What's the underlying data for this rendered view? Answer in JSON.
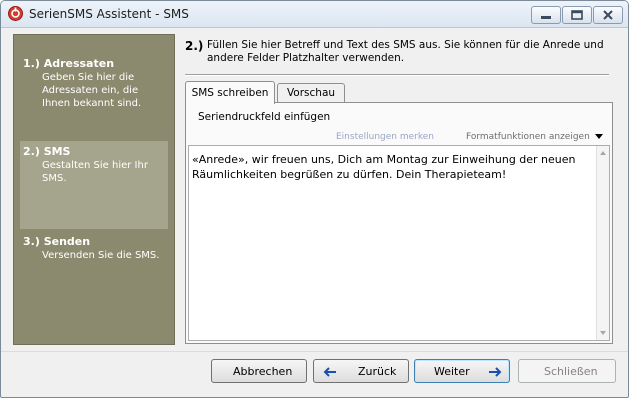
{
  "window": {
    "title": "SerienSMS Assistent - SMS",
    "icons": {
      "app": "app-icon",
      "minimize": "minimize-icon",
      "maximize": "maximize-icon",
      "close": "close-icon"
    }
  },
  "sidebar": {
    "steps": [
      {
        "title": "1.) Adressaten",
        "description": "Geben Sie hier die Adressaten ein, die Ihnen bekannt sind.",
        "active": false
      },
      {
        "title": "2.) SMS",
        "description": "Gestalten Sie hier Ihr SMS.",
        "active": true
      },
      {
        "title": "3.) Senden",
        "description": "Versenden Sie die SMS.",
        "active": false
      }
    ]
  },
  "header": {
    "number": "2.)",
    "text": "Füllen Sie hier Betreff und Text des SMS aus. Sie können für die Anrede und andere Felder Platzhalter verwenden."
  },
  "tabs": [
    {
      "label": "SMS schreiben",
      "active": true
    },
    {
      "label": "Vorschau",
      "active": false
    }
  ],
  "editor": {
    "merge_field_link": "Seriendruckfeld einfügen",
    "settings_link": "Einstellungen merken",
    "format_toggle": "Formatfunktionen anzeigen",
    "content": "«Anrede», wir freuen uns, Dich am Montag zur Einweihung der neuen Räumlichkeiten begrüßen zu dürfen. Dein Therapieteam!"
  },
  "buttons": {
    "cancel": "Abbrechen",
    "back": "Zurück",
    "next": "Weiter",
    "close": "Schließen",
    "back_icon": "arrow-left-icon",
    "next_icon": "arrow-right-icon"
  },
  "colors": {
    "sidebar_bg": "#8b8a6f",
    "sidebar_active": "#a5a48c",
    "arrow_blue": "#1a4fb0",
    "link_light": "#9aa6c6"
  }
}
